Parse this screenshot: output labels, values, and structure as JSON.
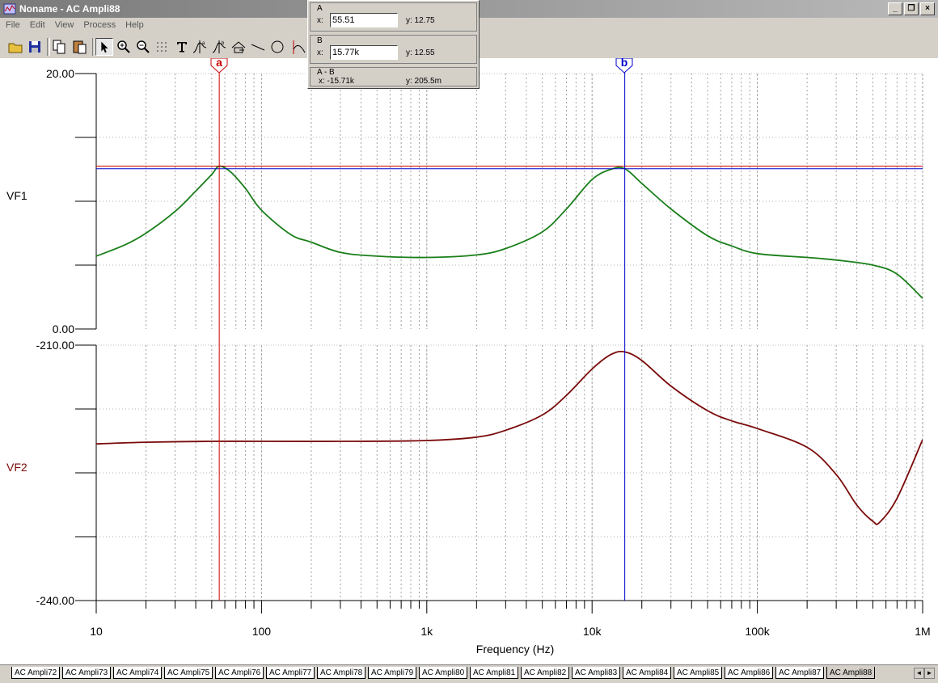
{
  "window": {
    "title": "Noname - AC Ampli88",
    "controls": [
      "_",
      "❐",
      "×"
    ]
  },
  "menu": [
    "File",
    "Edit",
    "View",
    "Process",
    "Help"
  ],
  "cursor_panel": {
    "a": {
      "label": "A",
      "x_label": "x:",
      "x_value": "55.51",
      "y_text": "y: 12.75"
    },
    "b": {
      "label": "B",
      "x_label": "x:",
      "x_value": "15.77k",
      "y_text": "y: 12.55"
    },
    "diff": {
      "label": "A - B",
      "x_text": "x:  -15.71k",
      "y_text": "y: 205.5m"
    }
  },
  "plot": {
    "xlabel": "Frequency (Hz)",
    "x_ticks": [
      "10",
      "100",
      "1k",
      "10k",
      "100k",
      "1M"
    ],
    "cursor_a_marker": "a",
    "cursor_b_marker": "b",
    "cursor_a_color": "#cc0000",
    "cursor_b_color": "#0000cc",
    "top": {
      "name": "VF1",
      "ymax": "20.00",
      "ymin": "0.00",
      "color": "#1a7f1a"
    },
    "bottom": {
      "name": "VF2",
      "ymax": "-210.00",
      "ymin": "-240.00",
      "color": "#7a0a0a"
    }
  },
  "chart_data": [
    {
      "type": "line",
      "title": "",
      "xlabel": "Frequency (Hz)",
      "ylabel": "VF1",
      "xscale": "log",
      "xlim": [
        10,
        1000000
      ],
      "ylim": [
        0,
        20
      ],
      "grid": true,
      "series": [
        {
          "name": "VF1",
          "x": [
            10,
            15,
            20,
            30,
            40,
            50,
            55.5,
            65,
            80,
            100,
            150,
            200,
            300,
            500,
            1000,
            2000,
            3000,
            5000,
            7000,
            10000,
            13000,
            15770,
            20000,
            30000,
            50000,
            70000,
            100000,
            200000,
            300000,
            500000,
            700000,
            1000000
          ],
          "y": [
            5.7,
            6.6,
            7.5,
            9.2,
            10.8,
            12.1,
            12.75,
            12.3,
            11.0,
            9.3,
            7.4,
            6.8,
            6.0,
            5.7,
            5.6,
            5.8,
            6.3,
            7.6,
            9.4,
            11.7,
            12.5,
            12.55,
            11.4,
            9.4,
            7.3,
            6.5,
            5.9,
            5.6,
            5.4,
            5.0,
            4.3,
            2.4
          ]
        }
      ]
    },
    {
      "type": "line",
      "title": "",
      "xlabel": "Frequency (Hz)",
      "ylabel": "VF2",
      "xscale": "log",
      "xlim": [
        10,
        1000000
      ],
      "ylim": [
        -240,
        -210
      ],
      "grid": true,
      "series": [
        {
          "name": "VF2",
          "x": [
            10,
            20,
            50,
            100,
            300,
            1000,
            2000,
            3000,
            5000,
            7000,
            10000,
            13000,
            15770,
            20000,
            30000,
            50000,
            70000,
            100000,
            200000,
            300000,
            400000,
            500000,
            550000,
            700000,
            1000000
          ],
          "y": [
            -221.6,
            -221.4,
            -221.3,
            -221.3,
            -221.3,
            -221.2,
            -220.8,
            -220.0,
            -218.2,
            -215.9,
            -212.8,
            -211.1,
            -210.8,
            -211.8,
            -214.8,
            -217.7,
            -218.9,
            -219.8,
            -222.0,
            -225.2,
            -228.8,
            -230.7,
            -230.8,
            -228.0,
            -221.1
          ]
        }
      ]
    }
  ],
  "tabs": [
    "AC Ampli72",
    "AC Ampli73",
    "AC Ampli74",
    "AC Ampli75",
    "AC Ampli76",
    "AC Ampli77",
    "AC Ampli78",
    "AC Ampli79",
    "AC Ampli80",
    "AC Ampli81",
    "AC Ampli82",
    "AC Ampli83",
    "AC Ampli84",
    "AC Ampli85",
    "AC Ampli86",
    "AC Ampli87",
    "AC Ampli88"
  ],
  "active_tab": "AC Ampli88"
}
